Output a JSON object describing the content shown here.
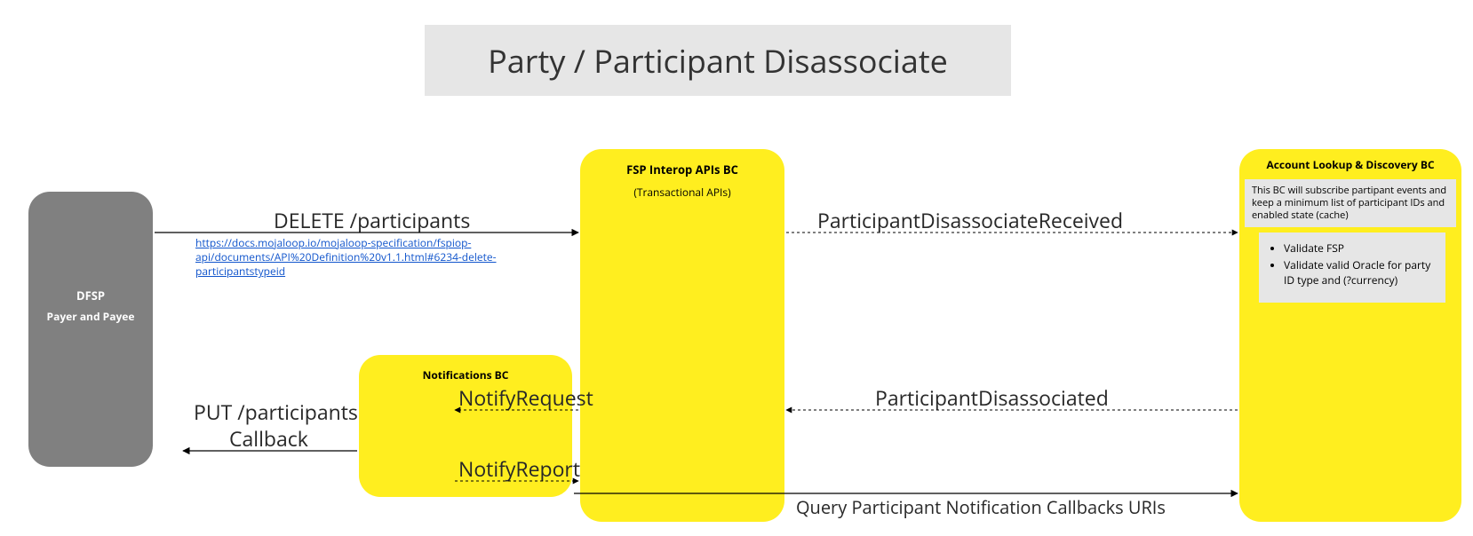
{
  "title": "Party / Participant Disassociate",
  "nodes": {
    "dfsp": {
      "title": "DFSP",
      "subtitle": "Payer and Payee"
    },
    "fsp": {
      "title": "FSP Interop APIs BC",
      "subtitle": "(Transactional APIs)"
    },
    "notifications": {
      "title": "Notifications BC"
    },
    "ald": {
      "title": "Account Lookup & Discovery BC",
      "note": "This BC will subscribe partipant events and keep a minimum list of participant IDs and enabled state (cache)",
      "steps": [
        "Validate FSP",
        "Validate valid Oracle for party ID type and (?currency)"
      ]
    }
  },
  "edges": {
    "delete_participants": "DELETE /participants",
    "spec_link": "https://docs.mojaloop.io/mojaloop-specification/fspiop-api/documents/API%20Definition%20v1.1.html#6234-delete-participantstypeid",
    "participant_disassociate_received": "ParticipantDisassociateReceived",
    "participant_disassociated": "ParticipantDisassociated",
    "notify_request": "NotifyRequest",
    "notify_report": "NotifyReport",
    "put_callback_l1": "PUT /participants",
    "put_callback_l2": "Callback",
    "query_callbacks": "Query Participant Notification Callbacks URIs"
  }
}
